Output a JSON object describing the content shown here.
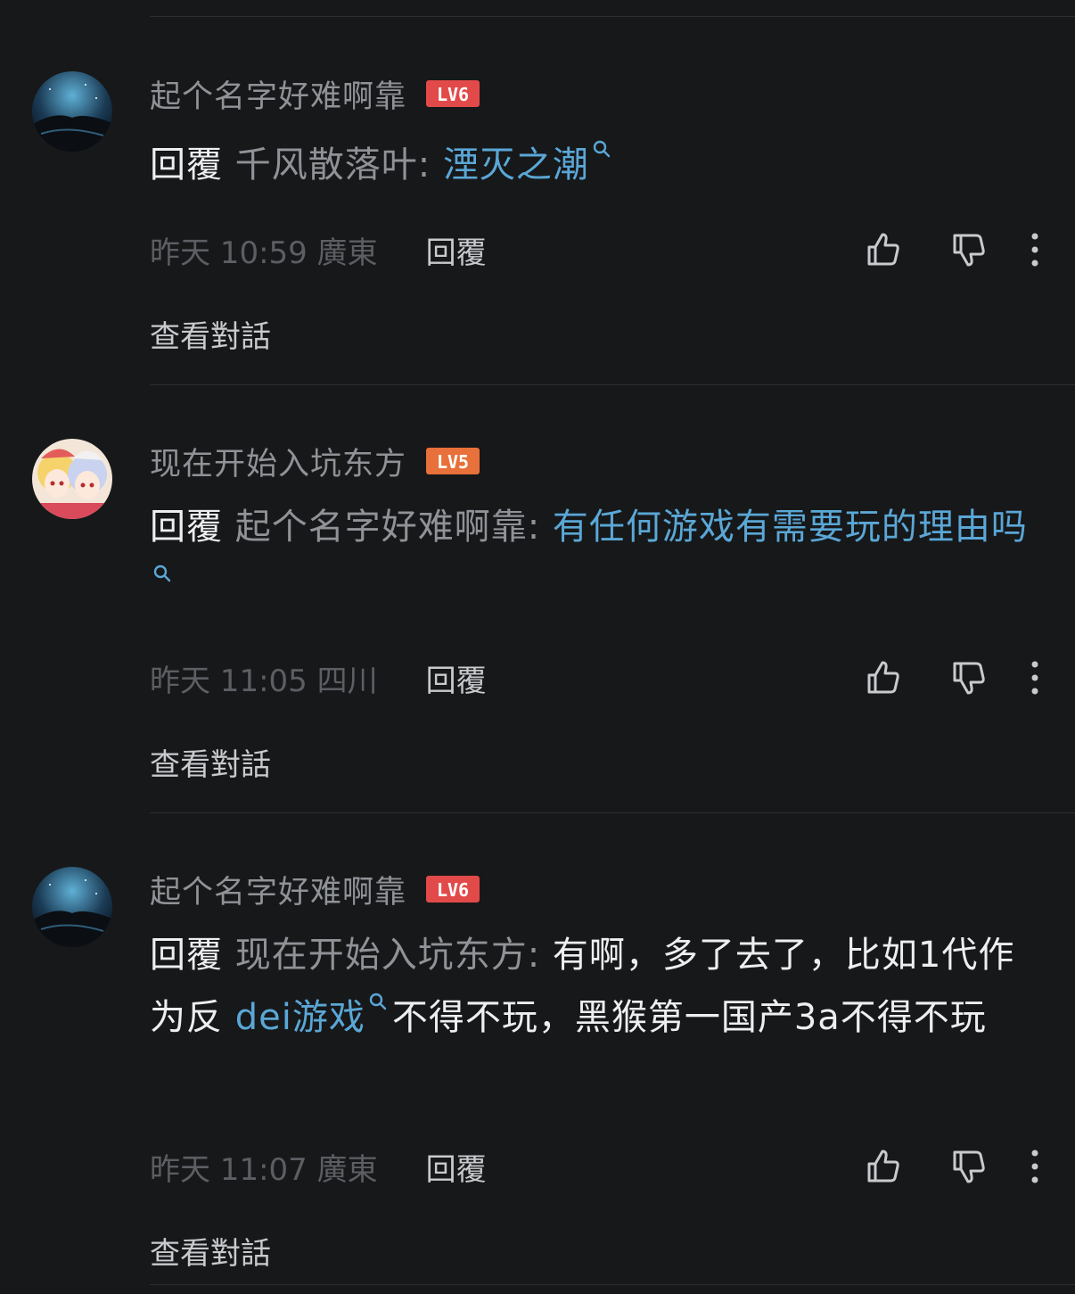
{
  "comments": [
    {
      "username": "起个名字好难啊靠",
      "level": "LV6",
      "reply_word": "回覆",
      "reply_target": "千风散落叶:",
      "segments": [
        {
          "text": "湮灭之潮",
          "link": true
        }
      ],
      "time_location": "昨天 10:59 廣東",
      "reply_label": "回覆",
      "view_thread": "查看對話"
    },
    {
      "username": "现在开始入坑东方",
      "level": "LV5",
      "reply_word": "回覆",
      "reply_target": "起个名字好难啊靠:",
      "segments": [
        {
          "text": "有任何游戏有需要玩的理由吗",
          "link": true
        }
      ],
      "time_location": "昨天 11:05 四川",
      "reply_label": "回覆",
      "view_thread": "查看對話"
    },
    {
      "username": "起个名字好难啊靠",
      "level": "LV6",
      "reply_word": "回覆",
      "reply_target": "现在开始入坑东方:",
      "segments": [
        {
          "text": "有啊，多了去了，比如1代作为反",
          "link": false
        },
        {
          "text": "dei游戏",
          "link": true
        },
        {
          "text": "不得不玩，黑猴第一国产3a不得不玩",
          "link": false
        }
      ],
      "time_location": "昨天 11:07 廣東",
      "reply_label": "回覆",
      "view_thread": "查看對話"
    }
  ],
  "icons": {
    "like": "thumbs-up-icon",
    "dislike": "thumbs-down-icon",
    "more": "more-vertical-icon",
    "search": "search-icon"
  },
  "colors": {
    "background": "#17181a",
    "link": "#5aa7d6",
    "badge": "#e24a4a"
  }
}
